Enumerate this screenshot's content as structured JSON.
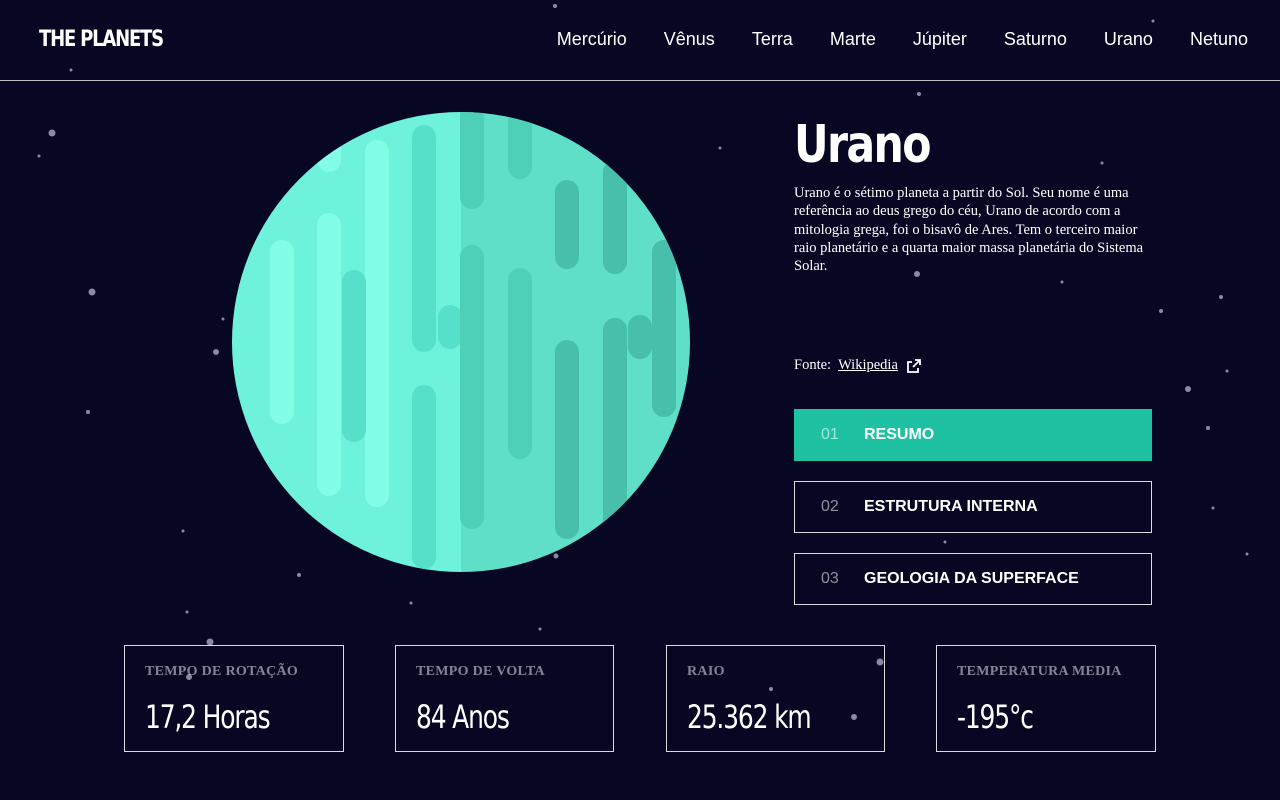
{
  "header": {
    "logo": "THE PLANETS",
    "nav": [
      "Mercúrio",
      "Vênus",
      "Terra",
      "Marte",
      "Júpiter",
      "Saturno",
      "Urano",
      "Netuno"
    ]
  },
  "planet": {
    "name": "Urano",
    "description": "Urano é o sétimo planeta a partir do Sol. Seu nome é uma referência ao deus grego do céu, Urano de acordo com a mitologia grega, foi o bisavô de Ares. Tem o terceiro maior raio planetário e a quarta maior massa planetária do Sistema Solar.",
    "source_label": "Fonte:",
    "source_link": "Wikipedia",
    "source_icon": "external-link-icon"
  },
  "tabs": [
    {
      "num": "01",
      "label": "RESUMO",
      "active": true
    },
    {
      "num": "02",
      "label": "ESTRUTURA INTERNA",
      "active": false
    },
    {
      "num": "03",
      "label": "GEOLOGIA DA SUPERFACE",
      "active": false
    }
  ],
  "stats": [
    {
      "label": "TEMPO DE ROTAÇÃO",
      "value": "17,2 Horas"
    },
    {
      "label": "TEMPO DE VOLTA",
      "value": "84 Anos"
    },
    {
      "label": "RAIO",
      "value": "25.362 km"
    },
    {
      "label": "TEMPERATURA MEDIA",
      "value": "-195°c"
    }
  ],
  "colors": {
    "background": "#070724",
    "accent": "#1ec1a2",
    "planet_light": "#6ff2dc",
    "planet_dark": "#2cc0a8"
  }
}
